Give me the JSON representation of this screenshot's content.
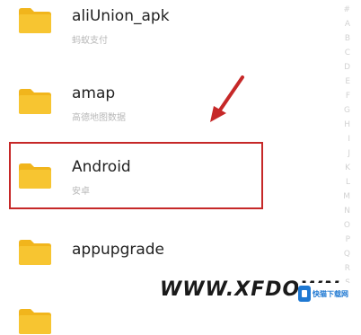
{
  "files": [
    {
      "name": "aliUnion_apk",
      "subtitle": "蚂蚁支付"
    },
    {
      "name": "amap",
      "subtitle": "高德地图数据"
    },
    {
      "name": "Android",
      "subtitle": "安卓"
    },
    {
      "name": "appupgrade",
      "subtitle": ""
    }
  ],
  "index_letters": [
    "#",
    "A",
    "B",
    "C",
    "D",
    "E",
    "F",
    "G",
    "H",
    "I",
    "J",
    "K",
    "L",
    "M",
    "N",
    "O",
    "P",
    "Q",
    "R",
    "S",
    "T"
  ],
  "watermark": {
    "text": "WWW.XFDOWN.",
    "logo_text": "快猫下载网"
  },
  "colors": {
    "folder": "#f7c531",
    "folder_tab": "#f1b51c",
    "highlight": "#c62828",
    "arrow": "#c62828",
    "logo": "#1e78d2"
  }
}
